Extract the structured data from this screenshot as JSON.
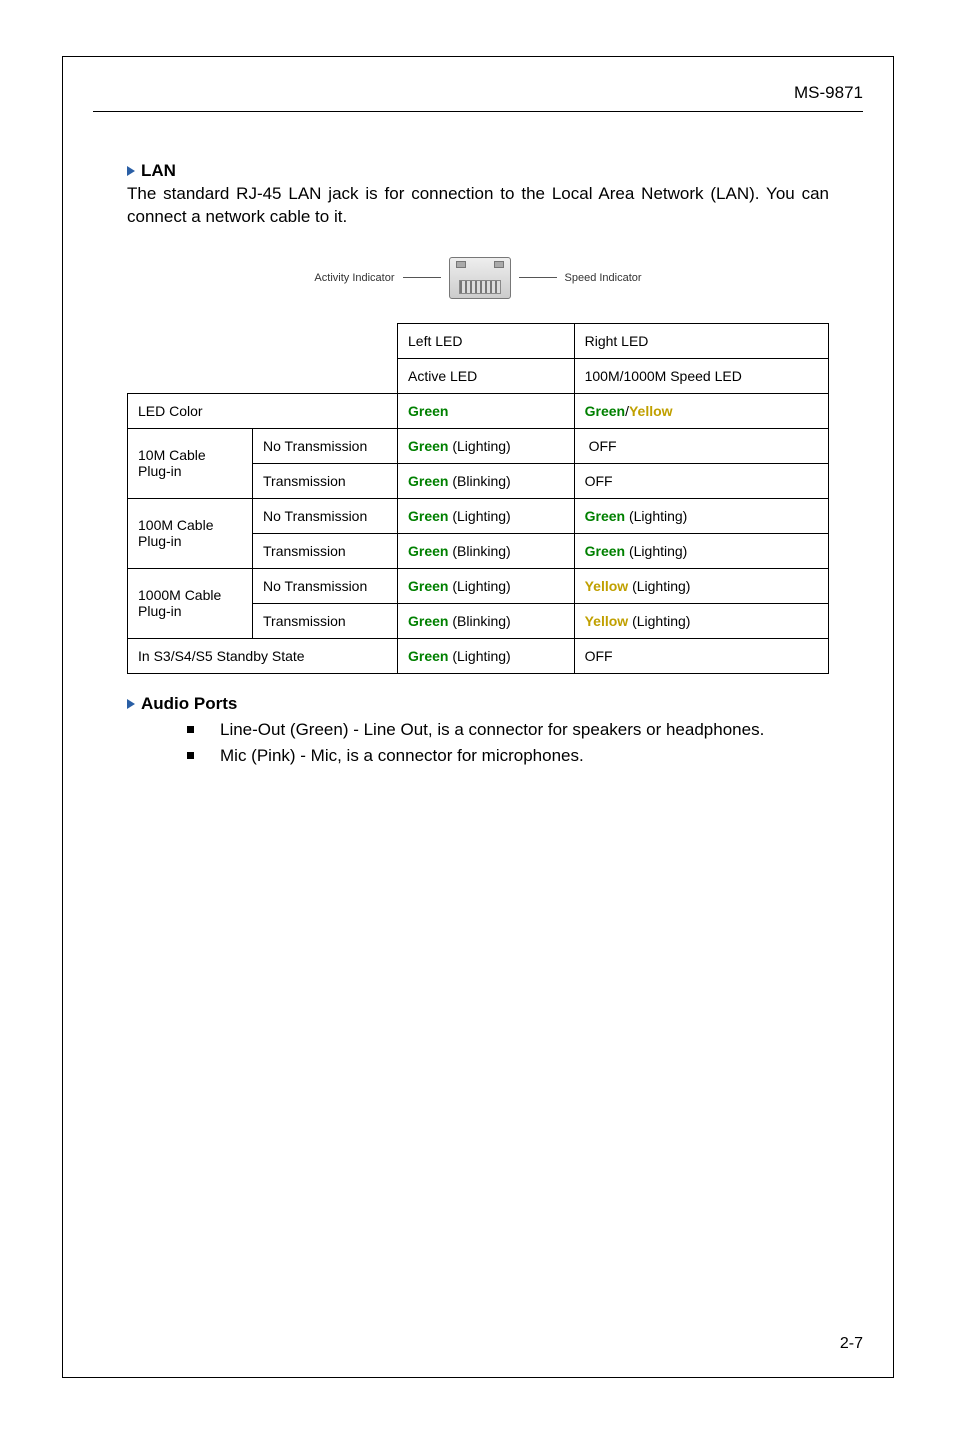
{
  "header": {
    "model": "MS-9871"
  },
  "lan": {
    "title": "LAN",
    "desc": "The standard RJ-45 LAN jack is for connection to the Local Area Network (LAN). You can connect a network cable to it.",
    "activity_label": "Activity Indicator",
    "speed_label": "Speed Indicator"
  },
  "table": {
    "left_led": "Left LED",
    "right_led": "Right LED",
    "active_led": "Active LED",
    "speed_led": "100M/1000M Speed LED",
    "led_color": "LED Color",
    "color_left": "Green",
    "color_right_a": "Green",
    "color_right_b": "Yellow",
    "row10_label": "10M Cable",
    "row100_label": "100M Cable",
    "row1000_label": "1000M Cable",
    "plugin": "Plug-in",
    "no_trans": "No Transmission",
    "trans": "Transmission",
    "green_lighting": "Green",
    "green_blinking": "Green",
    "lighting_sfx": " (Lighting)",
    "blinking_sfx": " (Blinking)",
    "off": "OFF",
    "yellow_lighting": "Yellow",
    "standby_label": "In S3/S4/S5 Standby State"
  },
  "audio": {
    "title": "Audio Ports",
    "line_out": "Line-Out (Green) - Line Out, is a connector for speakers or head­phones.",
    "mic": "Mic (Pink) - Mic, is a connector for microphones."
  },
  "footer": {
    "page": "2-7"
  }
}
